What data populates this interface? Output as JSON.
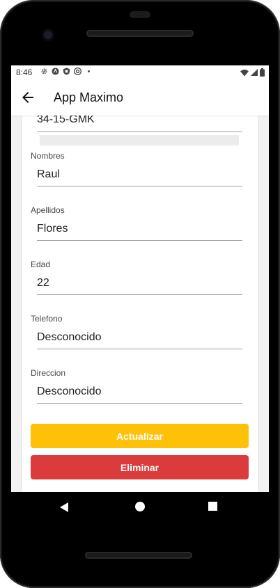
{
  "status_bar": {
    "time": "8:46",
    "left_icons": [
      "gear-icon",
      "android-icon",
      "shield-icon",
      "rotate-icon",
      "dot-icon"
    ],
    "right_icons": [
      "wifi-icon",
      "signal-icon",
      "battery-icon"
    ]
  },
  "app_bar": {
    "title": "App Maximo",
    "back_icon": "arrow-left-icon"
  },
  "form": {
    "plate_value": "34-15-GMK",
    "fields": [
      {
        "label": "Nombres",
        "value": "Raul"
      },
      {
        "label": "Apellidos",
        "value": "Flores"
      },
      {
        "label": "Edad",
        "value": "22"
      },
      {
        "label": "Telefono",
        "value": "Desconocido"
      },
      {
        "label": "Direccion",
        "value": "Desconocido"
      }
    ]
  },
  "buttons": {
    "update_label": "Actualizar",
    "delete_label": "Eliminar"
  },
  "colors": {
    "update_button": "#ffc107",
    "delete_button": "#db3b3a"
  },
  "nav_bar": {
    "icons": [
      "nav-back-icon",
      "nav-home-icon",
      "nav-recents-icon"
    ]
  }
}
